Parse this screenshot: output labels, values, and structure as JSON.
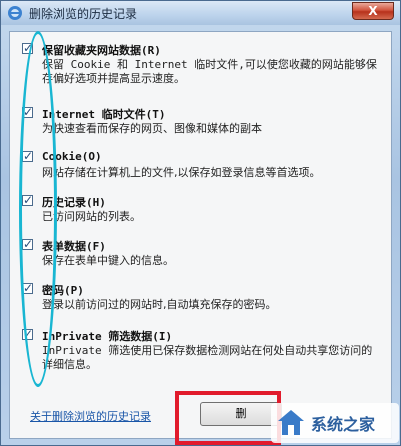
{
  "window": {
    "title": "删除浏览的历史记录",
    "close_label": "X"
  },
  "items": [
    {
      "title": "保留收藏夹网站数据(R)",
      "desc": "保留 Cookie 和 Internet 临时文件,可以使您收藏的网站能够保存偏好选项并提高显示速度。",
      "checked": true
    },
    {
      "title": "Internet 临时文件(T)",
      "desc": "为快速查看而保存的网页、图像和媒体的副本",
      "checked": true
    },
    {
      "title": "Cookie(O)",
      "desc": "网站存储在计算机上的文件,以保存如登录信息等首选项。",
      "checked": true
    },
    {
      "title": "历史记录(H)",
      "desc": "已访问网站的列表。",
      "checked": true
    },
    {
      "title": "表单数据(F)",
      "desc": "保存在表单中键入的信息。",
      "checked": true
    },
    {
      "title": "密码(P)",
      "desc": "登录以前访问过的网站时,自动填充保存的密码。",
      "checked": true
    },
    {
      "title": "InPrivate 筛选数据(I)",
      "desc": "InPrivate 筛选使用已保存数据检测网站在何处自动共享您访问的详细信息。",
      "checked": true
    }
  ],
  "footer": {
    "link_label": "关于删除浏览的历史记录",
    "delete_label": "删"
  },
  "watermark": {
    "text": "系统之家"
  },
  "colors": {
    "annotation_red": "#e11b2c",
    "annotation_cyan": "#19b6d2",
    "link_blue": "#1a56a8"
  }
}
